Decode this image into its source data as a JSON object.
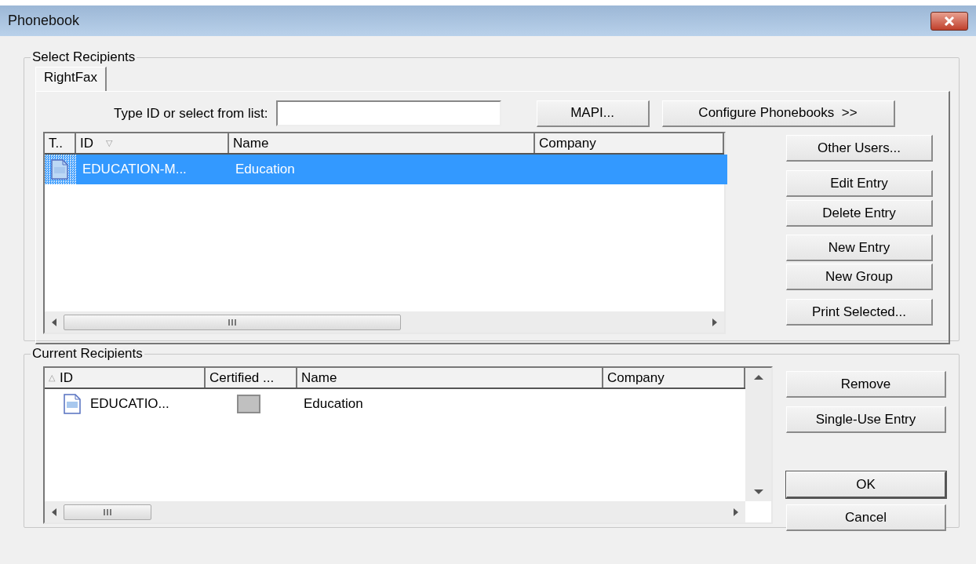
{
  "window": {
    "title": "Phonebook"
  },
  "select_recipients": {
    "title": "Select Recipients",
    "tabs": [
      {
        "label": "RightFax",
        "selected": true
      }
    ],
    "id_field": {
      "label": "Type ID or select from list:"
    },
    "top_buttons": [
      {
        "label": "MAPI..."
      },
      {
        "label": "Configure Phonebooks  >>"
      }
    ],
    "list": {
      "columns": [
        {
          "label": "T.."
        },
        {
          "label": "ID",
          "sort_mark": "▽"
        },
        {
          "label": "Name"
        },
        {
          "label": "Company"
        }
      ],
      "rows": [
        {
          "id": "EDUCATION-M...",
          "name": "Education",
          "selected": true
        }
      ]
    },
    "side_buttons": [
      {
        "label": "Other Users..."
      },
      {
        "label": "Edit Entry"
      },
      {
        "label": "Delete Entry"
      },
      {
        "label": "New Entry"
      },
      {
        "label": "New Group"
      },
      {
        "label": "Print Selected..."
      }
    ]
  },
  "current_recipients": {
    "title": "Current Recipients",
    "list": {
      "columns": [
        {
          "sort_mark": "△",
          "label": "ID"
        },
        {
          "label": "Certified ..."
        },
        {
          "label": "Name"
        },
        {
          "label": "Company"
        }
      ],
      "rows": [
        {
          "id": "EDUCATIO...",
          "certified": false,
          "name": "Education",
          "selected": false
        }
      ]
    },
    "buttons": [
      {
        "label": "Remove",
        "default": false
      },
      {
        "label": "Single-Use Entry",
        "default": false
      },
      {
        "label": "OK",
        "default": true
      },
      {
        "label": "Cancel",
        "default": false
      }
    ]
  }
}
